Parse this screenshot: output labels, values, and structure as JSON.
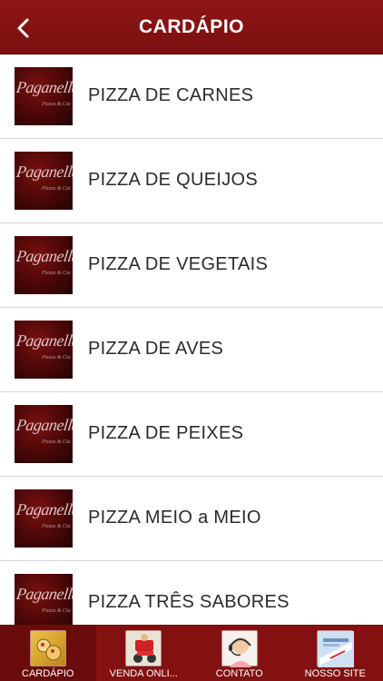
{
  "header": {
    "title": "CARDÁPIO",
    "back_icon": "chevron-left-icon"
  },
  "logo": {
    "brand": "Paganella",
    "tagline": "Pizzas & Cia"
  },
  "menu": {
    "items": [
      {
        "label": "PIZZA DE CARNES"
      },
      {
        "label": "PIZZA DE QUEIJOS"
      },
      {
        "label": "PIZZA DE VEGETAIS"
      },
      {
        "label": "PIZZA DE AVES"
      },
      {
        "label": "PIZZA DE PEIXES"
      },
      {
        "label": "PIZZA MEIO a MEIO"
      },
      {
        "label": "PIZZA TRÊS SABORES"
      }
    ]
  },
  "tabbar": {
    "active": "CARDÁPIO",
    "tabs": [
      {
        "label": "CARDÁPIO",
        "icon": "menu-icon"
      },
      {
        "label": "VENDA ONLI...",
        "icon": "delivery-scooter-icon"
      },
      {
        "label": "CONTATO",
        "icon": "support-headset-icon"
      },
      {
        "label": "NOSSO SITE",
        "icon": "website-icon"
      }
    ]
  },
  "colors": {
    "header_bg": "#8e1616",
    "tabbar_bg": "#831111",
    "text": "#2b2b2b",
    "divider": "#d7d7d7"
  }
}
